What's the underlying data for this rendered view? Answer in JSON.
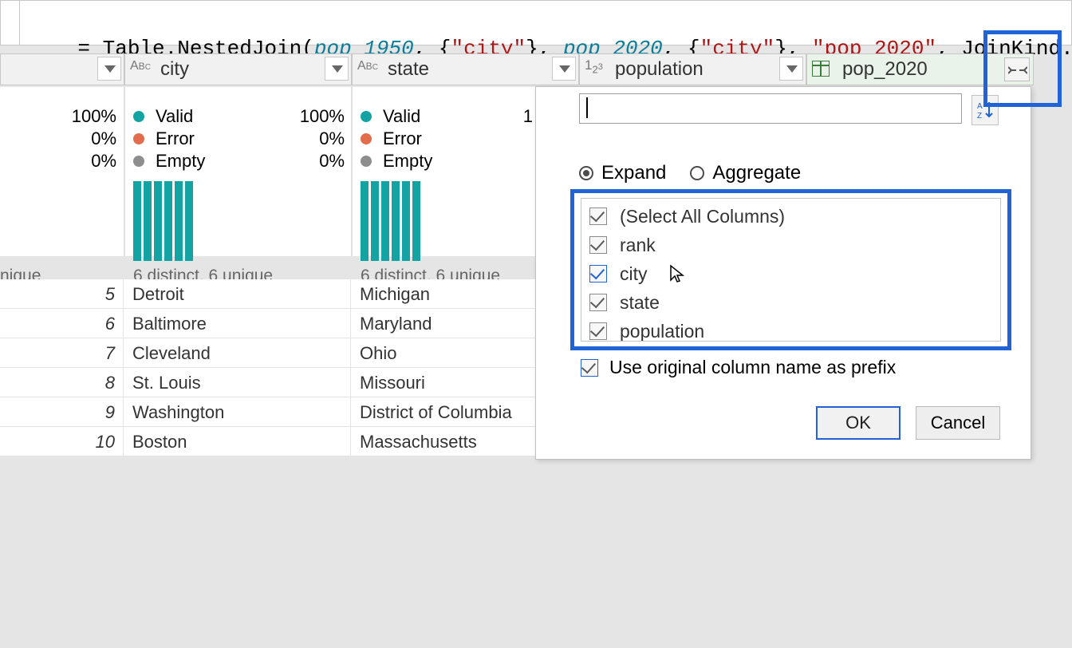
{
  "formula": {
    "prefix": "= Table.NestedJoin(",
    "arg1": "pop_1950",
    "sep1": ", {",
    "str1": "\"city\"",
    "sep2": "}, ",
    "arg2": "pop_2020",
    "sep3": ", {",
    "str2": "\"city\"",
    "sep4": "}, ",
    "str3": "\"pop_2020\"",
    "sep5": ", JoinKind.LeftAnti)"
  },
  "columns": {
    "c1": {
      "name": "city",
      "type": "ABC"
    },
    "c2": {
      "name": "state",
      "type": "ABC"
    },
    "c3": {
      "name": "population",
      "type": "123"
    },
    "c4": {
      "name": "pop_2020"
    }
  },
  "profile": {
    "partial_unique": "nique",
    "valid_label": "Valid",
    "error_label": "Error",
    "empty_label": "Empty",
    "valid_pct": "100%",
    "error_pct": "0%",
    "empty_pct": "0%",
    "distinct": "6 distinct, 6 unique",
    "c3_partial_pct": "1"
  },
  "rows": [
    {
      "rank": "5",
      "city": "Detroit",
      "state": "Michigan"
    },
    {
      "rank": "6",
      "city": "Baltimore",
      "state": "Maryland"
    },
    {
      "rank": "7",
      "city": "Cleveland",
      "state": "Ohio"
    },
    {
      "rank": "8",
      "city": "St. Louis",
      "state": "Missouri"
    },
    {
      "rank": "9",
      "city": "Washington",
      "state": "District of Columbia"
    },
    {
      "rank": "10",
      "city": "Boston",
      "state": "Massachusetts"
    }
  ],
  "popup": {
    "expand_label": "Expand",
    "aggregate_label": "Aggregate",
    "select_all": "(Select All Columns)",
    "cols": [
      "rank",
      "city",
      "state",
      "population"
    ],
    "prefix_label": "Use original column name as prefix",
    "ok": "OK",
    "cancel": "Cancel"
  }
}
